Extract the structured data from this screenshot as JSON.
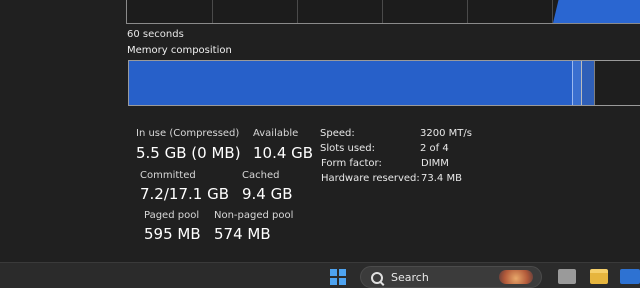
{
  "graph": {
    "time_label": "60 seconds"
  },
  "composition": {
    "title": "Memory composition"
  },
  "stats": {
    "in_use_label": "In use (Compressed)",
    "in_use_value": "5.5 GB (0 MB)",
    "available_label": "Available",
    "available_value": "10.4 GB",
    "committed_label": "Committed",
    "committed_value": "7.2/17.1 GB",
    "cached_label": "Cached",
    "cached_value": "9.4 GB",
    "paged_pool_label": "Paged pool",
    "paged_pool_value": "595 MB",
    "nonpaged_pool_label": "Non-paged pool",
    "nonpaged_pool_value": "574 MB"
  },
  "specs": {
    "speed_label": "Speed:",
    "speed_value": "3200 MT/s",
    "slots_label": "Slots used:",
    "slots_value": "2 of 4",
    "form_label": "Form factor:",
    "form_value": "DIMM",
    "hw_reserved_label": "Hardware reserved:",
    "hw_reserved_value": "73.4 MB"
  },
  "taskbar": {
    "search_label": "Search",
    "icons": [
      "windows-start-icon",
      "search-icon",
      "app-icon",
      "file-explorer-icon",
      "app-icon"
    ]
  },
  "colors": {
    "accent": "#2760c9",
    "background": "#202020"
  }
}
